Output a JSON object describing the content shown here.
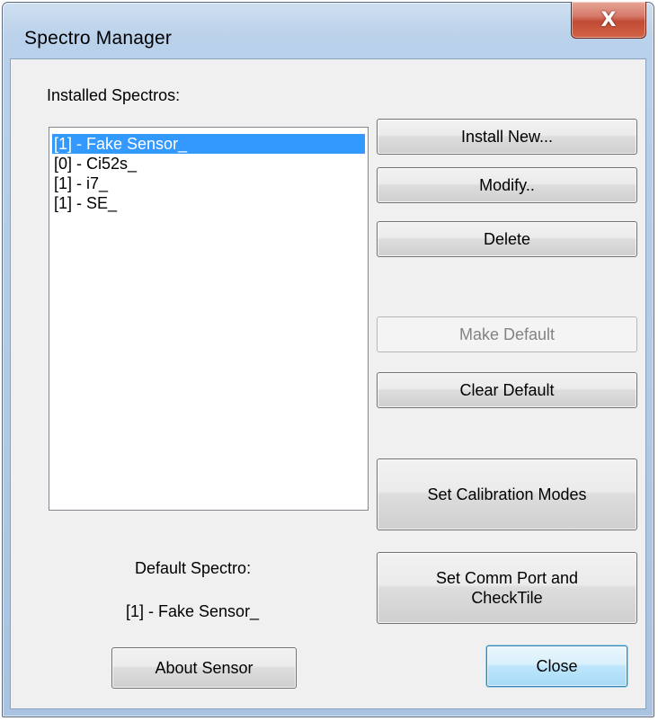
{
  "window": {
    "title": "Spectro Manager",
    "close_glyph": "X"
  },
  "installed_label": "Installed Spectros:",
  "spectros": [
    {
      "label": "[1] - Fake Sensor_",
      "selected": true
    },
    {
      "label": "[0] - Ci52s_",
      "selected": false
    },
    {
      "label": "[1] - i7_",
      "selected": false
    },
    {
      "label": "[1] - SE_",
      "selected": false
    }
  ],
  "buttons": {
    "install_new": "Install New...",
    "modify": "Modify..",
    "delete": "Delete",
    "make_default": "Make Default",
    "clear_default": "Clear Default",
    "set_calibration_modes": "Set Calibration Modes",
    "set_comm_port_line1": "Set Comm Port and",
    "set_comm_port_line2": "CheckTile",
    "about_sensor": "About Sensor",
    "close": "Close"
  },
  "default_spectro": {
    "label": "Default Spectro:",
    "value": "[1] - Fake Sensor_"
  },
  "colors": {
    "selection": "#3399ff",
    "close_button": "#c04a34"
  }
}
